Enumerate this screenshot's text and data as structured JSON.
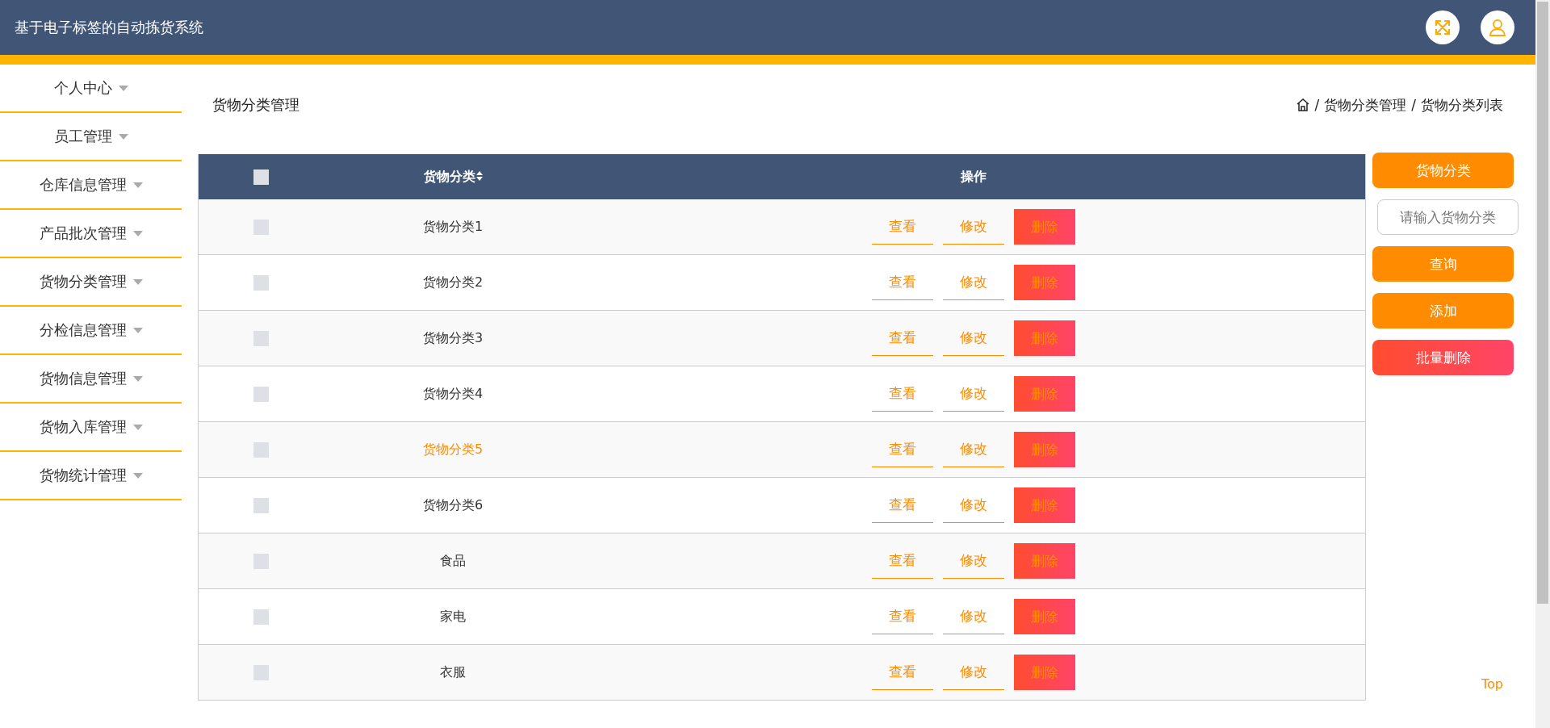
{
  "header": {
    "title": "基于电子标签的自动拣货系统"
  },
  "sidebar": {
    "items": [
      {
        "label": "个人中心"
      },
      {
        "label": "员工管理"
      },
      {
        "label": "仓库信息管理"
      },
      {
        "label": "产品批次管理"
      },
      {
        "label": "货物分类管理"
      },
      {
        "label": "分检信息管理"
      },
      {
        "label": "货物信息管理"
      },
      {
        "label": "货物入库管理"
      },
      {
        "label": "货物统计管理"
      }
    ]
  },
  "page_title": "货物分类管理",
  "breadcrumb": [
    {
      "separator": "/",
      "label": "货物分类管理"
    },
    {
      "separator": "/",
      "label": "货物分类列表"
    }
  ],
  "table": {
    "columns": [
      "货物分类",
      "操作"
    ],
    "header_checked": false,
    "rows": [
      {
        "category": "货物分类1",
        "checked": false,
        "highlighted": false,
        "actions": [
          "查看",
          "修改",
          "删除"
        ]
      },
      {
        "category": "货物分类2",
        "checked": false,
        "highlighted": false,
        "actions": [
          "查看",
          "修改",
          "删除"
        ]
      },
      {
        "category": "货物分类3",
        "checked": false,
        "highlighted": false,
        "actions": [
          "查看",
          "修改",
          "删除"
        ]
      },
      {
        "category": "货物分类4",
        "checked": false,
        "highlighted": false,
        "actions": [
          "查看",
          "修改",
          "删除"
        ]
      },
      {
        "category": "货物分类5",
        "checked": false,
        "highlighted": true,
        "actions": [
          "查看",
          "修改",
          "删除"
        ]
      },
      {
        "category": "货物分类6",
        "checked": false,
        "highlighted": false,
        "actions": [
          "查看",
          "修改",
          "删除"
        ]
      },
      {
        "category": "食品",
        "checked": false,
        "highlighted": false,
        "actions": [
          "查看",
          "修改",
          "删除"
        ]
      },
      {
        "category": "家电",
        "checked": false,
        "highlighted": false,
        "actions": [
          "查看",
          "修改",
          "删除"
        ]
      },
      {
        "category": "衣服",
        "checked": false,
        "highlighted": false,
        "actions": [
          "查看",
          "修改",
          "删除"
        ]
      }
    ]
  },
  "side_panel": {
    "label": "货物分类",
    "search": {
      "placeholder": "请输入货物分类"
    },
    "buttons": [
      {
        "label": "查询",
        "kind": "primary"
      },
      {
        "label": "添加",
        "kind": "primary"
      },
      {
        "label": "批量删除",
        "kind": "danger"
      }
    ]
  },
  "top_link": "Top"
}
